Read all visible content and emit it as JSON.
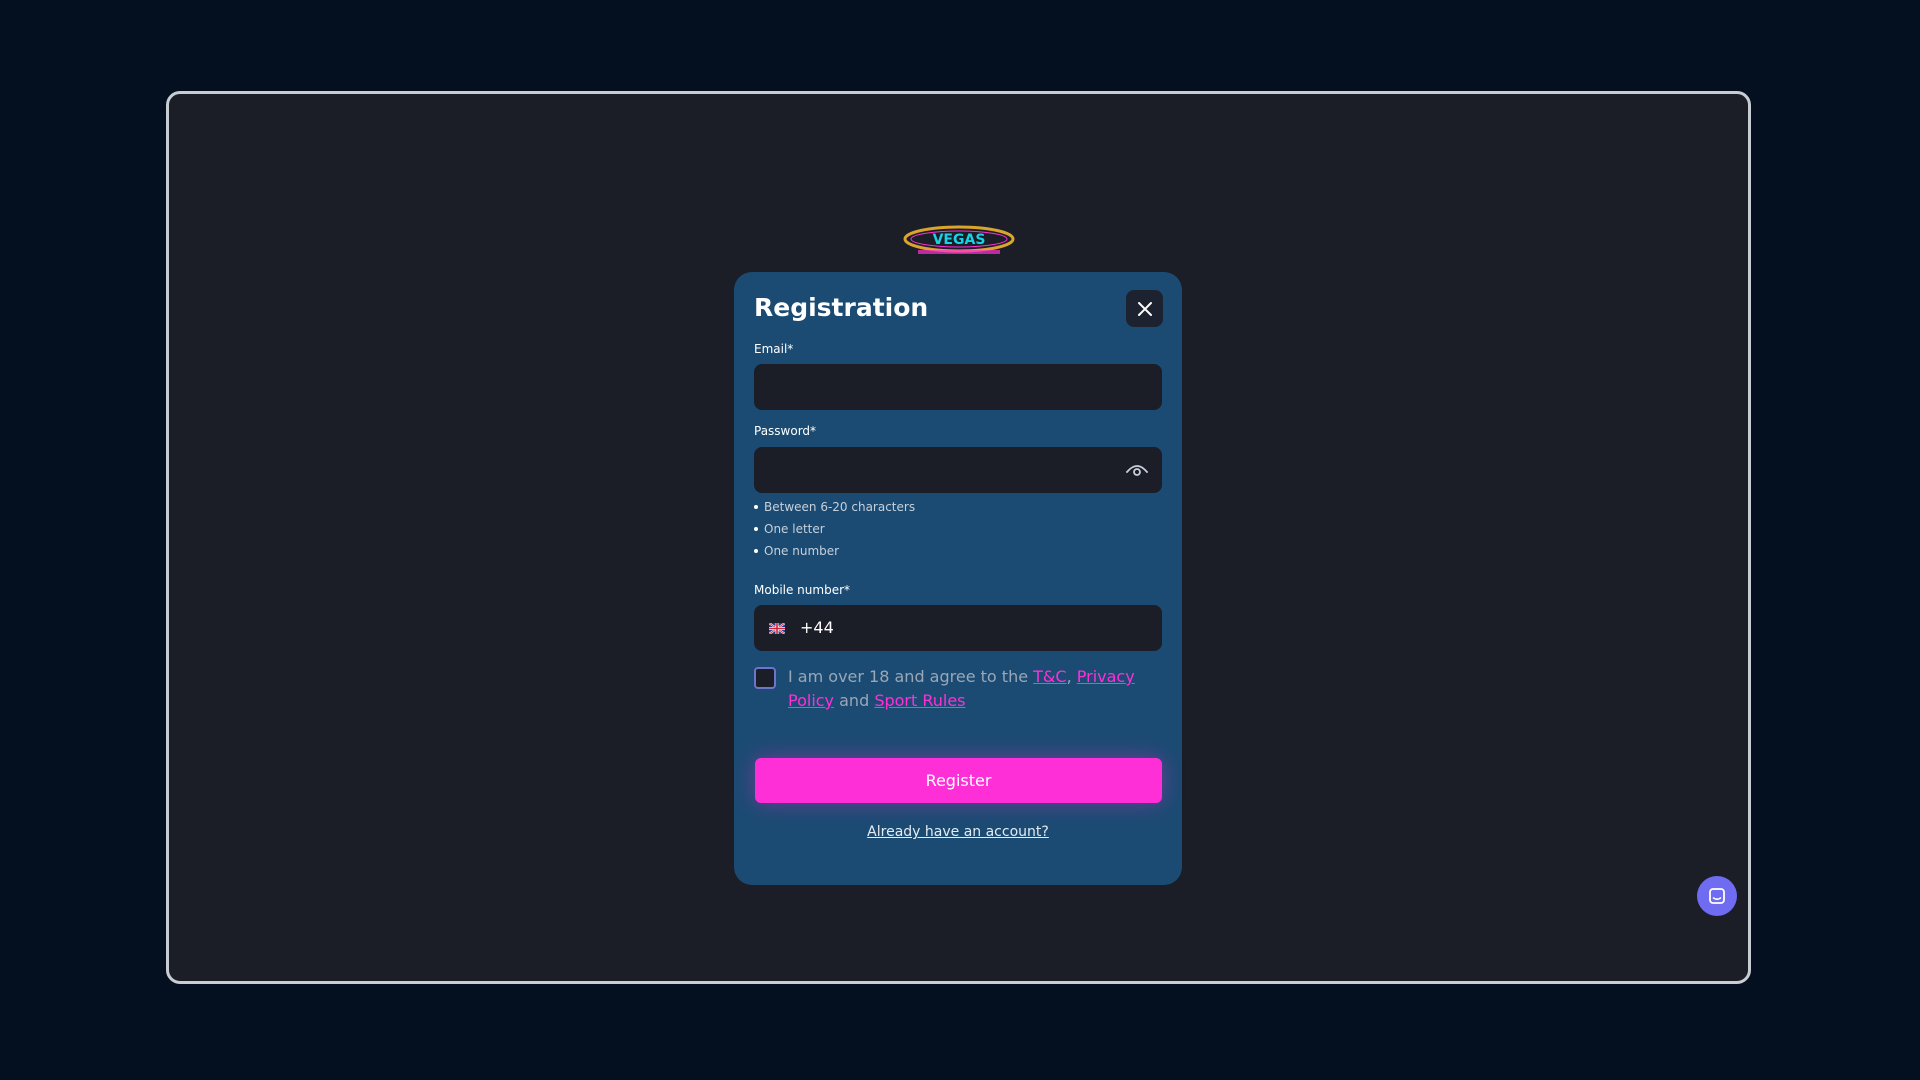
{
  "brand": {
    "logo_icon": "vegas-casino-logo",
    "logo_text": "VEGAS"
  },
  "modal": {
    "title": "Registration",
    "close_icon": "close-icon"
  },
  "email": {
    "label": "Email*",
    "value": "",
    "placeholder": ""
  },
  "password": {
    "label": "Password*",
    "value": "",
    "placeholder": "",
    "toggle_icon": "eye-icon",
    "requirements": [
      "Between 6-20 characters",
      "One letter",
      "One number"
    ]
  },
  "mobile": {
    "label": "Mobile number*",
    "flag_icon": "uk-flag-icon",
    "dial_code": "+44",
    "value": ""
  },
  "terms": {
    "checked": false,
    "prefix": "I am over 18 and agree to the ",
    "tc_link": "T&C",
    "sep": ",",
    "privacy_link": "Privacy Policy",
    "and": " and ",
    "sport_rules_link": "Sport Rules"
  },
  "actions": {
    "register_label": "Register",
    "login_link": "Already have an account?"
  },
  "chat": {
    "icon": "chat-icon"
  },
  "colors": {
    "accent": "#ff2fd8",
    "modal_bg": "#1b4b73",
    "input_bg": "#1b1d27",
    "page_bg": "#041020",
    "chat": "#6f6cf2"
  }
}
